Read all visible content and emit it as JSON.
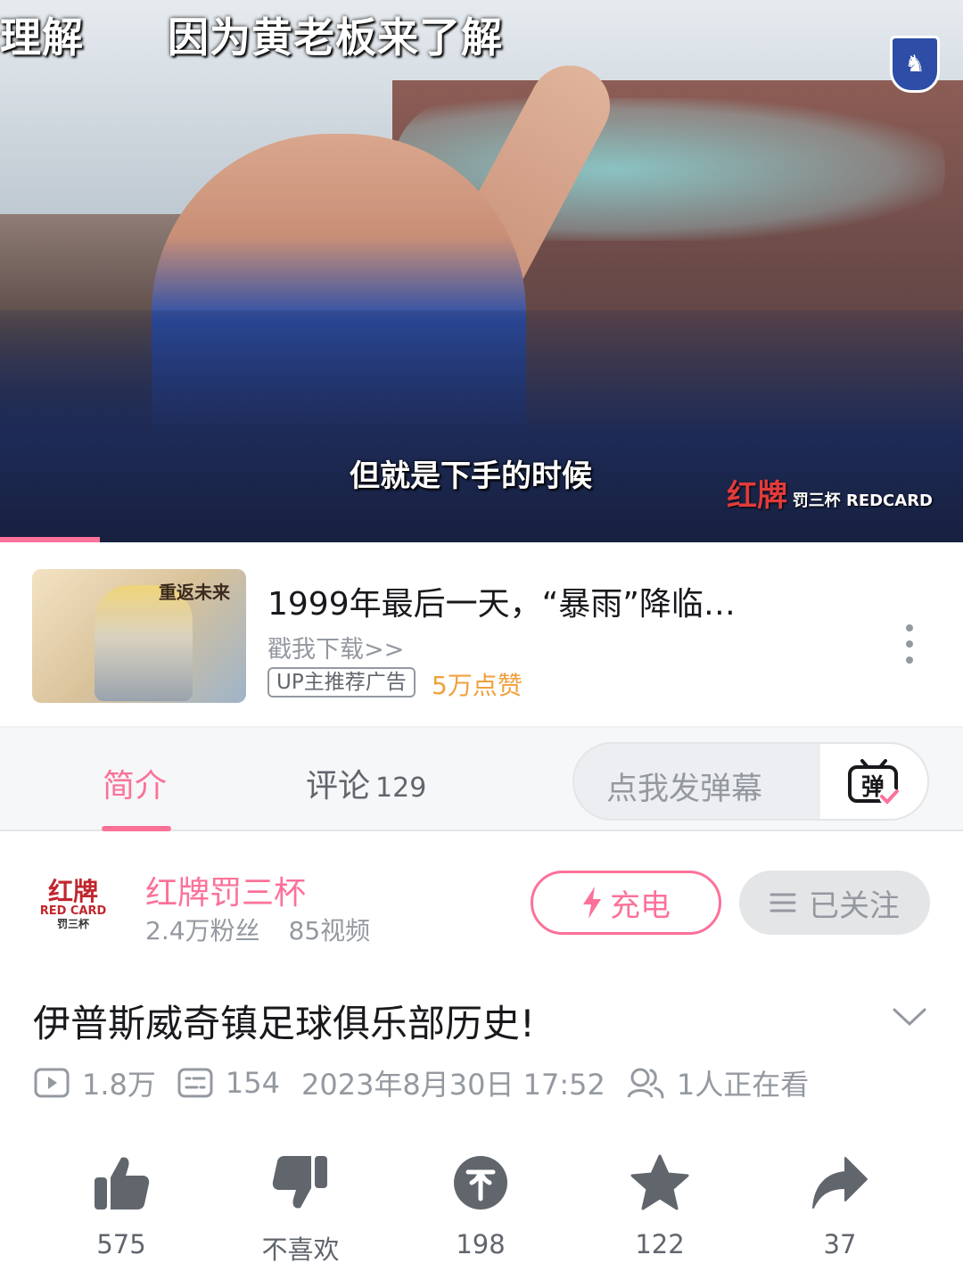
{
  "video": {
    "subtitle_top_left": "理解",
    "subtitle_top_main": "因为黄老板来了解",
    "subtitle_bottom": "但就是下手的时候",
    "watermark_main": "红牌",
    "watermark_sub": "罚三杯 REDCARD",
    "progress_fraction": 0.104
  },
  "ad": {
    "thumb_logo": "重返未来",
    "title": "1999年最后一天，“暴雨”降临…",
    "subtitle": "戳我下载>>",
    "tag": "UP主推荐广告",
    "likes": "5万点赞",
    "more_icon": "more-vertical-icon"
  },
  "tabs": {
    "intro": "简介",
    "comments": "评论",
    "comments_count": "129",
    "danmu_placeholder": "点我发弹幕",
    "danmu_icon": "danmu-icon"
  },
  "uploader": {
    "avatar_line1": "红牌",
    "avatar_line2": "RED CARD",
    "avatar_line3": "罚三杯",
    "name": "红牌罚三杯",
    "fans": "2.4万粉丝",
    "videos": "85视频",
    "charge_label": "充电",
    "followed_label": "已关注"
  },
  "video_info": {
    "title": "伊普斯威奇镇足球俱乐部历史!",
    "views": "1.8万",
    "danmaku_count": "154",
    "datetime": "2023年8月30日 17:52",
    "watching": "1人正在看"
  },
  "actions": {
    "like": "575",
    "dislike": "不喜欢",
    "coin": "198",
    "favorite": "122",
    "share": "37"
  },
  "colors": {
    "accent": "#fb7299",
    "gray_text": "#9499a0",
    "icon_gray": "#61666d",
    "orange": "#f0a03d"
  }
}
